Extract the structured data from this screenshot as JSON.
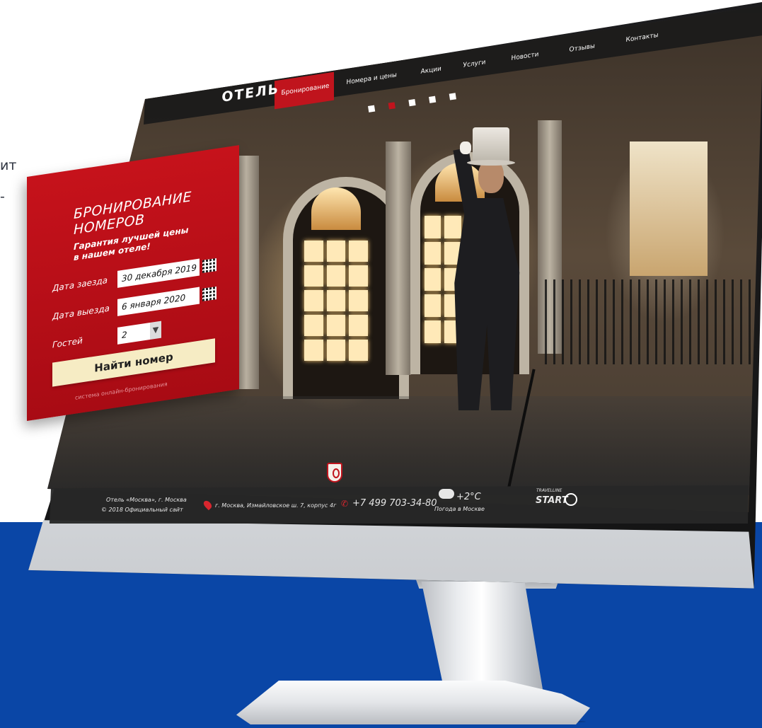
{
  "page": {
    "background_band_color": "#0a46a6",
    "accent_color": "#c0141d"
  },
  "side_text": {
    "line1": "ит",
    "line2": "-"
  },
  "site": {
    "logo": "ОТЕЛЬ",
    "nav": [
      {
        "label": "Бронирование",
        "active": true
      },
      {
        "label": "Номера и цены"
      },
      {
        "label": "Акции"
      },
      {
        "label": "Услуги"
      },
      {
        "label": "Новости"
      },
      {
        "label": "Отзывы"
      },
      {
        "label": "Контакты"
      }
    ],
    "slider": {
      "count": 5,
      "active_index": 1
    }
  },
  "booking": {
    "title_line1": "БРОНИРОВАНИЕ",
    "title_line2": "НОМЕРОВ",
    "subtitle_line1": "Гарантия лучшей цены",
    "subtitle_line2": "в нашем отеле!",
    "checkin_label": "Дата заезда",
    "checkin_value": "30 декабря 2019",
    "checkout_label": "Дата выезда",
    "checkout_value": "6 января 2020",
    "guests_label": "Гостей",
    "guests_value": "2",
    "search_button": "Найти номер",
    "system_text": "система онлайн-бронирования"
  },
  "footer": {
    "hotel_name": "Отель «Москва», г. Москва",
    "copyright": "© 2018 Официальный сайт",
    "address": "г. Москва, Измайловское ш. 7, корпус 4г",
    "phone": "+7 499 703-34-80",
    "temperature": "+2°C",
    "weather_caption": "Погода в Москве",
    "partner_top": "TRAVELLINE",
    "partner_name": "START"
  }
}
